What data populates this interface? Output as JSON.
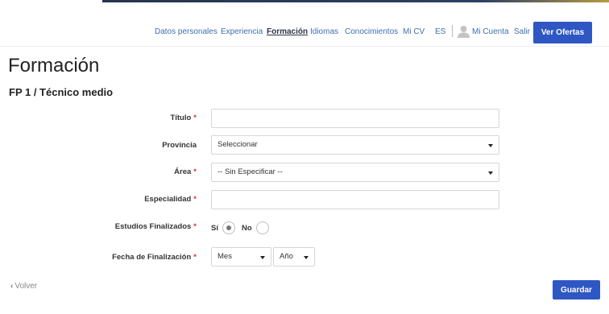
{
  "nav": {
    "items": [
      {
        "label": "Datos personales"
      },
      {
        "label": "Experiencia"
      },
      {
        "label": "Formación"
      },
      {
        "label": "Idiomas"
      },
      {
        "label": "Conocimientos"
      },
      {
        "label": "Mi CV"
      }
    ],
    "active": "Formación",
    "language": "ES",
    "account_label": "Mi Cuenta",
    "logout_label": "Salir",
    "cta_label": "Ver Ofertas",
    "accent_color": "#2e57c3"
  },
  "page": {
    "title": "Formación",
    "section": "FP 1 / Técnico medio"
  },
  "form": {
    "titulo": {
      "label": "Título",
      "required": true,
      "value": ""
    },
    "provincia": {
      "label": "Provincia",
      "required": false,
      "value": "Seleccionar"
    },
    "area": {
      "label": "Área",
      "required": true,
      "value": "-- Sin Especificar --"
    },
    "especialidad": {
      "label": "Especialidad",
      "required": true,
      "value": ""
    },
    "estudios_finalizados": {
      "label": "Estudios Finalizados",
      "required": true,
      "options": [
        "Sí",
        "No"
      ],
      "selected": "Sí"
    },
    "fecha_finalizacion": {
      "label": "Fecha de Finalización",
      "required": true,
      "month_value": "Mes",
      "year_value": "Año"
    },
    "required_marker": "*"
  },
  "footer": {
    "back_label": "Volver",
    "save_label": "Guardar"
  }
}
